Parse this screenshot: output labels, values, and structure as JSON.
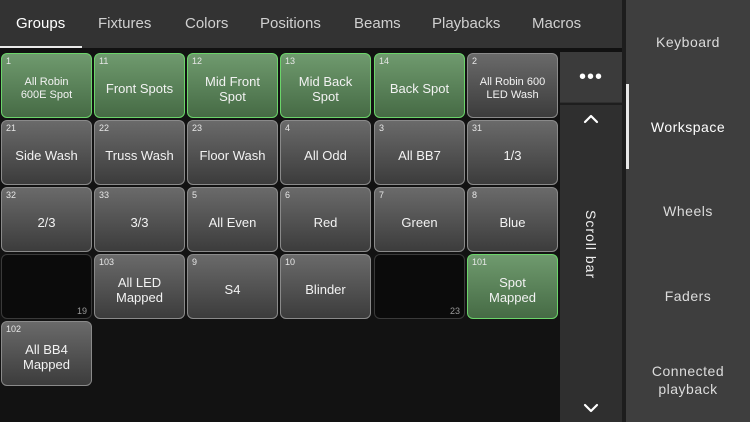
{
  "tabs": [
    {
      "label": "Groups",
      "active": true
    },
    {
      "label": "Fixtures"
    },
    {
      "label": "Colors"
    },
    {
      "label": "Positions"
    },
    {
      "label": "Beams"
    },
    {
      "label": "Playbacks"
    },
    {
      "label": "Macros"
    }
  ],
  "grid": {
    "rows": [
      [
        {
          "num": "1",
          "label": "All Robin\n600E Spot",
          "style": "green"
        },
        {
          "num": "11",
          "label": "Front Spots",
          "style": "green"
        },
        {
          "num": "12",
          "label": "Mid Front\nSpot",
          "style": "green"
        },
        {
          "num": "13",
          "label": "Mid Back\nSpot",
          "style": "green"
        },
        {
          "num": "14",
          "label": "Back Spot",
          "style": "green"
        },
        {
          "num": "2",
          "label": "All Robin 600\nLED Wash",
          "style": "normal"
        }
      ],
      [
        {
          "num": "21",
          "label": "Side Wash",
          "style": "normal"
        },
        {
          "num": "22",
          "label": "Truss Wash",
          "style": "normal"
        },
        {
          "num": "23",
          "label": "Floor Wash",
          "style": "normal"
        },
        {
          "num": "4",
          "label": "All Odd",
          "style": "normal"
        },
        {
          "num": "3",
          "label": "All BB7",
          "style": "normal"
        },
        {
          "num": "31",
          "label": "1/3",
          "style": "normal"
        }
      ],
      [
        {
          "num": "32",
          "label": "2/3",
          "style": "normal"
        },
        {
          "num": "33",
          "label": "3/3",
          "style": "normal"
        },
        {
          "num": "5",
          "label": "All Even",
          "style": "normal"
        },
        {
          "num": "6",
          "label": "Red",
          "style": "normal"
        },
        {
          "num": "7",
          "label": "Green",
          "style": "normal"
        },
        {
          "num": "8",
          "label": "Blue",
          "style": "normal"
        }
      ],
      [
        {
          "num_br": "19",
          "label": "",
          "style": "empty"
        },
        {
          "num": "103",
          "label": "All LED\nMapped",
          "style": "normal"
        },
        {
          "num": "9",
          "label": "S4",
          "style": "normal"
        },
        {
          "num": "10",
          "label": "Blinder",
          "style": "normal"
        },
        {
          "num_br": "23",
          "label": "",
          "style": "empty"
        },
        {
          "num": "101",
          "label": "Spot\nMapped",
          "style": "green"
        }
      ],
      [
        {
          "num": "102",
          "label": "All BB4\nMapped",
          "style": "normal"
        }
      ]
    ]
  },
  "scroll": {
    "more_label": "•••",
    "bar_label": "Scroll bar"
  },
  "sidebar": {
    "items": [
      {
        "label": "Keyboard"
      },
      {
        "label": "Workspace",
        "active": true
      },
      {
        "label": "Wheels"
      },
      {
        "label": "Faders"
      },
      {
        "label": "Connected\nplayback"
      }
    ]
  },
  "colors": {
    "green_border": "#6bd56a",
    "green_fill": "#5c865b",
    "grey_fill": "#555555",
    "background": "#121212"
  }
}
